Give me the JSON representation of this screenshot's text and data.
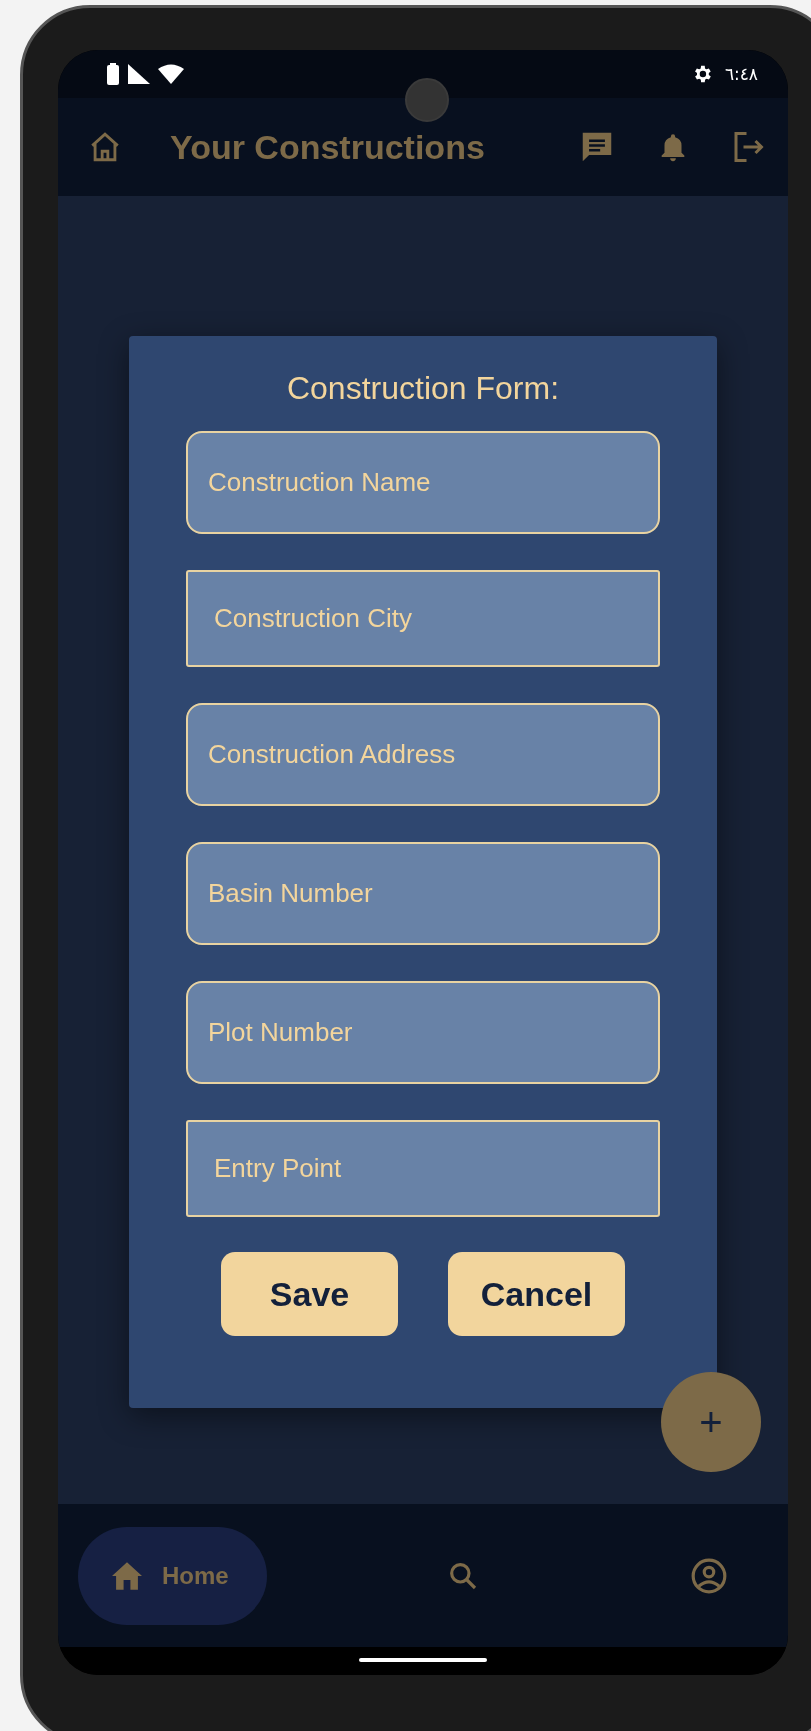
{
  "status_bar": {
    "time": "٦:٤٨"
  },
  "app_bar": {
    "title": "Your Constructions"
  },
  "dialog": {
    "title": "Construction Form:",
    "fields": [
      {
        "placeholder": "Construction Name",
        "kind": "rounded"
      },
      {
        "placeholder": "Construction City",
        "kind": "square"
      },
      {
        "placeholder": "Construction Address",
        "kind": "rounded"
      },
      {
        "placeholder": "Basin Number",
        "kind": "rounded"
      },
      {
        "placeholder": "Plot Number",
        "kind": "rounded"
      },
      {
        "placeholder": "Entry Point",
        "kind": "square"
      }
    ],
    "buttons": [
      "Save",
      "Cancel"
    ]
  },
  "fab": {
    "label": "+"
  },
  "bottom_nav": [
    {
      "kind": "home",
      "label": "Home",
      "selected": true
    },
    {
      "kind": "search",
      "selected": false
    },
    {
      "kind": "profile",
      "selected": false
    }
  ]
}
